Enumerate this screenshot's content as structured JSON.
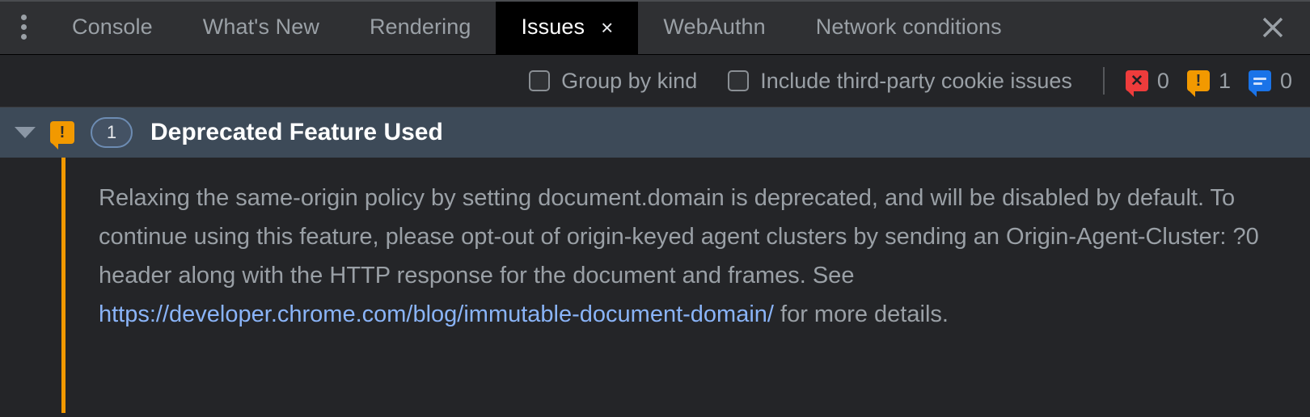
{
  "tabbar": {
    "menu_icon": "more-vertical-icon",
    "close_icon": "close-icon",
    "tabs": [
      {
        "label": "Console",
        "active": false
      },
      {
        "label": "What's New",
        "active": false
      },
      {
        "label": "Rendering",
        "active": false
      },
      {
        "label": "Issues",
        "active": true,
        "close_glyph": "×"
      },
      {
        "label": "WebAuthn",
        "active": false
      },
      {
        "label": "Network conditions",
        "active": false
      }
    ]
  },
  "toolbar": {
    "group_by_kind": {
      "label": "Group by kind",
      "checked": false
    },
    "third_party": {
      "label": "Include third-party cookie issues",
      "checked": false
    },
    "counters": {
      "errors": {
        "icon": "error-bubble-icon",
        "count": "0",
        "color": "#ee3c3c",
        "glyph": "✕"
      },
      "warnings": {
        "icon": "warning-bubble-icon",
        "count": "1",
        "color": "#f29900",
        "glyph": "!"
      },
      "info": {
        "icon": "info-bubble-icon",
        "count": "0",
        "color": "#1a73e8"
      }
    }
  },
  "issue": {
    "expanded": true,
    "expander_icon": "chevron-down-triangle-icon",
    "kind_icon": "warning-bubble-icon",
    "count": "1",
    "title": "Deprecated Feature Used",
    "accent_color": "#f29900",
    "body_part1": "Relaxing the same-origin policy by setting document.domain is deprecated, and will be disabled by default. To continue using this feature, please opt-out of origin-keyed agent clusters by sending an Origin-Agent-Cluster: ?0 header along with the HTTP response for the document and frames. See ",
    "link_text": "https://developer.chrome.com/blog/immutable-document-domain/",
    "body_part2": " for more details.",
    "link_color": "#8ab4f8"
  }
}
